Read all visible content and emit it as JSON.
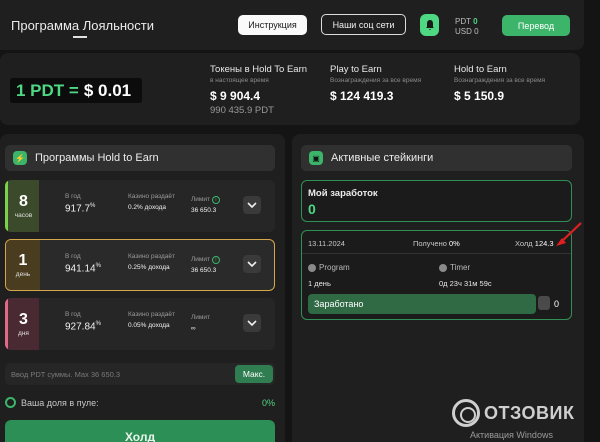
{
  "header": {
    "title": "Программа Лояльности",
    "instructions_label": "Инструкция",
    "social_label": "Наши соц сети",
    "balance_pdt": "PDT",
    "balance_pdt_value": "0",
    "balance_usd": "USD",
    "balance_usd_value": "0",
    "transfer_label": "Перевод"
  },
  "stats": {
    "price_pdt": "1 PDT =",
    "price_usd": "$ 0.01",
    "tokens_label": "Токены в Hold To Earn",
    "tokens_sub": "в настоящее время",
    "tokens_value": "$ 9 904.4",
    "tokens_value_pdt": "990 435.9 PDT",
    "play_label": "Play to Earn",
    "play_sub": "Вознаграждения за все время",
    "play_value": "$ 124 419.3",
    "hold_label": "Hold to Earn",
    "hold_sub": "Вознаграждения за все время",
    "hold_value": "$ 5 150.9"
  },
  "programs": {
    "title": "Программы Hold to Earn",
    "year_label": "В год",
    "casino_label": "Казино раздаёт",
    "limit_label": "Лимит",
    "items": [
      {
        "num": "8",
        "unit": "часов",
        "rate": "917.7",
        "rate_unit": "%",
        "share": "0.2% дохода",
        "limit": "36 650.3"
      },
      {
        "num": "1",
        "unit": "день",
        "rate": "941.14",
        "rate_unit": "%",
        "share": "0.25% дохода",
        "limit": "36 650.3"
      },
      {
        "num": "3",
        "unit": "дня",
        "rate": "927.84",
        "rate_unit": "%",
        "share": "0.05% дохода",
        "limit": "∞"
      }
    ],
    "input_placeholder": "Ввод PDT суммы. Max 36 650.3",
    "max_label": "Макс.",
    "pool_label": "Ваша доля в пуле:",
    "pool_value": "0%",
    "hold_button": "Холд"
  },
  "stakings": {
    "title": "Активные стейкинги",
    "my_earnings_label": "Мой заработок",
    "my_earnings_value": "0",
    "date": "13.11.2024",
    "received_label": "Получено",
    "received_value": "0%",
    "hold_label": "Холд",
    "hold_value": "124.3",
    "program_label": "Program",
    "program_value": "1 день",
    "timer_label": "Timer",
    "timer_value": "0д 23ч 31м 59с",
    "earned_label": "Заработано",
    "earned_value": "0"
  },
  "watermark": {
    "brand": "ОТЗОВИК",
    "activation": "Активация Windows"
  },
  "colors": {
    "accent": "#3cb56b",
    "accent_bright": "#4fd883",
    "active_border": "#d6a64a",
    "arrow": "#e02020"
  }
}
